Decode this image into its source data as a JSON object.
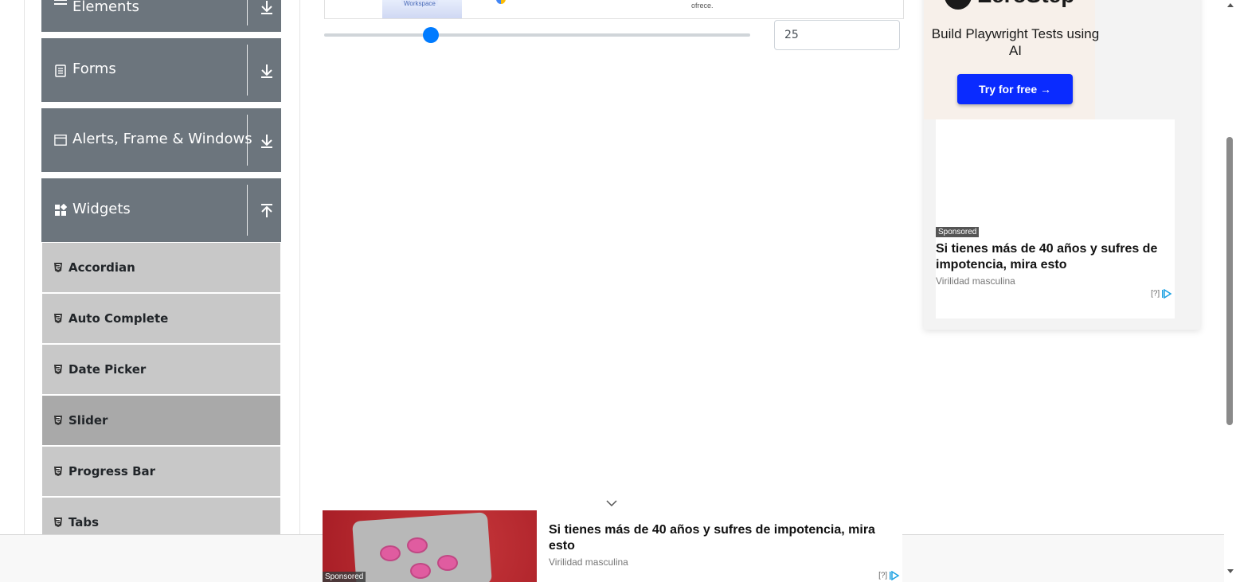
{
  "sidebar": {
    "groups": [
      {
        "label": "Elements",
        "icon": "menu-lines-icon",
        "toggle": "download-arrow-icon"
      },
      {
        "label": "Forms",
        "icon": "form-document-icon",
        "toggle": "download-arrow-icon"
      },
      {
        "label": "Alerts, Frame & Windows",
        "icon": "window-frame-icon",
        "toggle": "download-arrow-icon"
      },
      {
        "label": "Widgets",
        "icon": "widgets-grid-icon",
        "toggle": "upload-arrow-icon"
      }
    ],
    "widget_items": [
      {
        "label": "Accordian",
        "active": false
      },
      {
        "label": "Auto Complete",
        "active": false
      },
      {
        "label": "Date Picker",
        "active": false
      },
      {
        "label": "Slider",
        "active": true
      },
      {
        "label": "Progress Bar",
        "active": false
      },
      {
        "label": "Tabs",
        "active": false
      }
    ]
  },
  "main": {
    "top_ad": {
      "image_tag": "Workspace",
      "small_text": "ofrece."
    },
    "slider": {
      "value": "25",
      "min": 0,
      "max": 100,
      "level": 25,
      "accent": "#007bff"
    }
  },
  "side_ad": {
    "brand": "ZeroStep",
    "headline": "Build Playwright Tests using AI",
    "cta": "Try for free →",
    "cta_color": "#0a2bff",
    "card": {
      "sponsored": "Sponsored",
      "title": "Si tienes más de 40 años y sufres de impotencia, mira esto",
      "source": "Virilidad masculina",
      "adchoices": "[?]"
    }
  },
  "bottom_ad": {
    "sponsored": "Sponsored",
    "title": "Si tienes más de 40 años y sufres de impotencia, mira esto",
    "source": "Virilidad masculina",
    "adchoices": "[?]"
  },
  "colors": {
    "group_header": "#6c757d",
    "menu_item": "#c8c8c8",
    "menu_item_active": "#a9a9a9"
  }
}
